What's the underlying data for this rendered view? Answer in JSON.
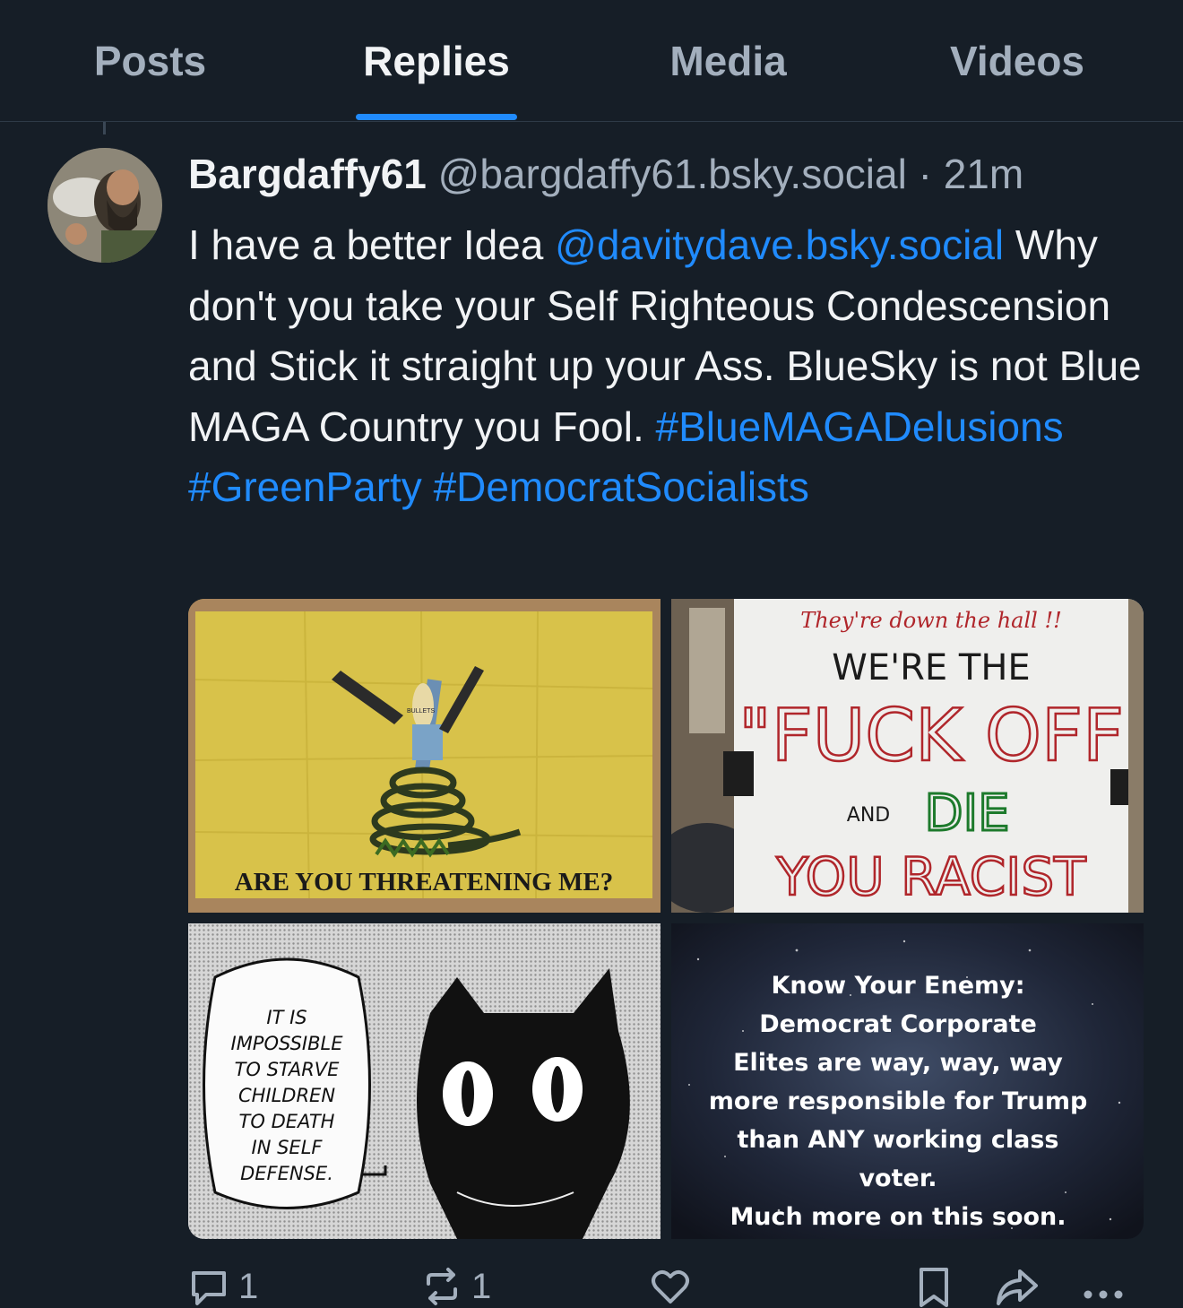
{
  "tabs": [
    {
      "label": "Posts"
    },
    {
      "label": "Replies"
    },
    {
      "label": "Media"
    },
    {
      "label": "Videos"
    }
  ],
  "active_tab": "Replies",
  "post": {
    "author": "Bargdaffy61",
    "handle": "@bargdaffy61.bsky.social",
    "separator": "·",
    "time": "21m",
    "text_before_mention": "I have a better Idea ",
    "mention": "@davitydave.bsky.social",
    "text_after_mention": " Why don't you take your Self Righteous Condescension and Stick it straight up your Ass. BlueSky is not Blue MAGA Country you Fool. ",
    "hashtags": [
      "#BlueMAGADelusions",
      "#GreenParty",
      "#DemocratSocialists"
    ],
    "images": [
      {
        "alt": "Yellow flag with cartoon character and coiled snake",
        "caption": "ARE YOU THREATENING ME?",
        "shirt_text": "BULLETS"
      },
      {
        "alt": "Handwritten protest sign",
        "top_line": "They're down the hall !!",
        "lines": [
          "WE'RE THE",
          "\"FUCK OFF",
          "AND",
          "DIE",
          "YOU RACIST"
        ]
      },
      {
        "alt": "Manga panel with black cat and speech bubble",
        "bubble_lines": [
          "IT IS",
          "IMPOSSIBLE",
          "TO STARVE",
          "CHILDREN",
          "TO DEATH",
          "IN SELF",
          "DEFENSE."
        ]
      },
      {
        "alt": "Starry sky background with text",
        "lines": [
          "Know Your Enemy:",
          "Democrat Corporate",
          "Elites are way, way, way",
          "more responsible for Trump",
          "than ANY working class",
          "voter.",
          "Much more on this soon."
        ]
      }
    ]
  },
  "actions": {
    "reply_count": "1",
    "repost_count": "1"
  },
  "colors": {
    "background": "#161e27",
    "text": "#f1f3f5",
    "muted": "#a3afbd",
    "accent": "#208bfe"
  },
  "icons": [
    "reply-icon",
    "repost-icon",
    "like-icon",
    "bookmark-icon",
    "share-icon",
    "more-icon"
  ]
}
